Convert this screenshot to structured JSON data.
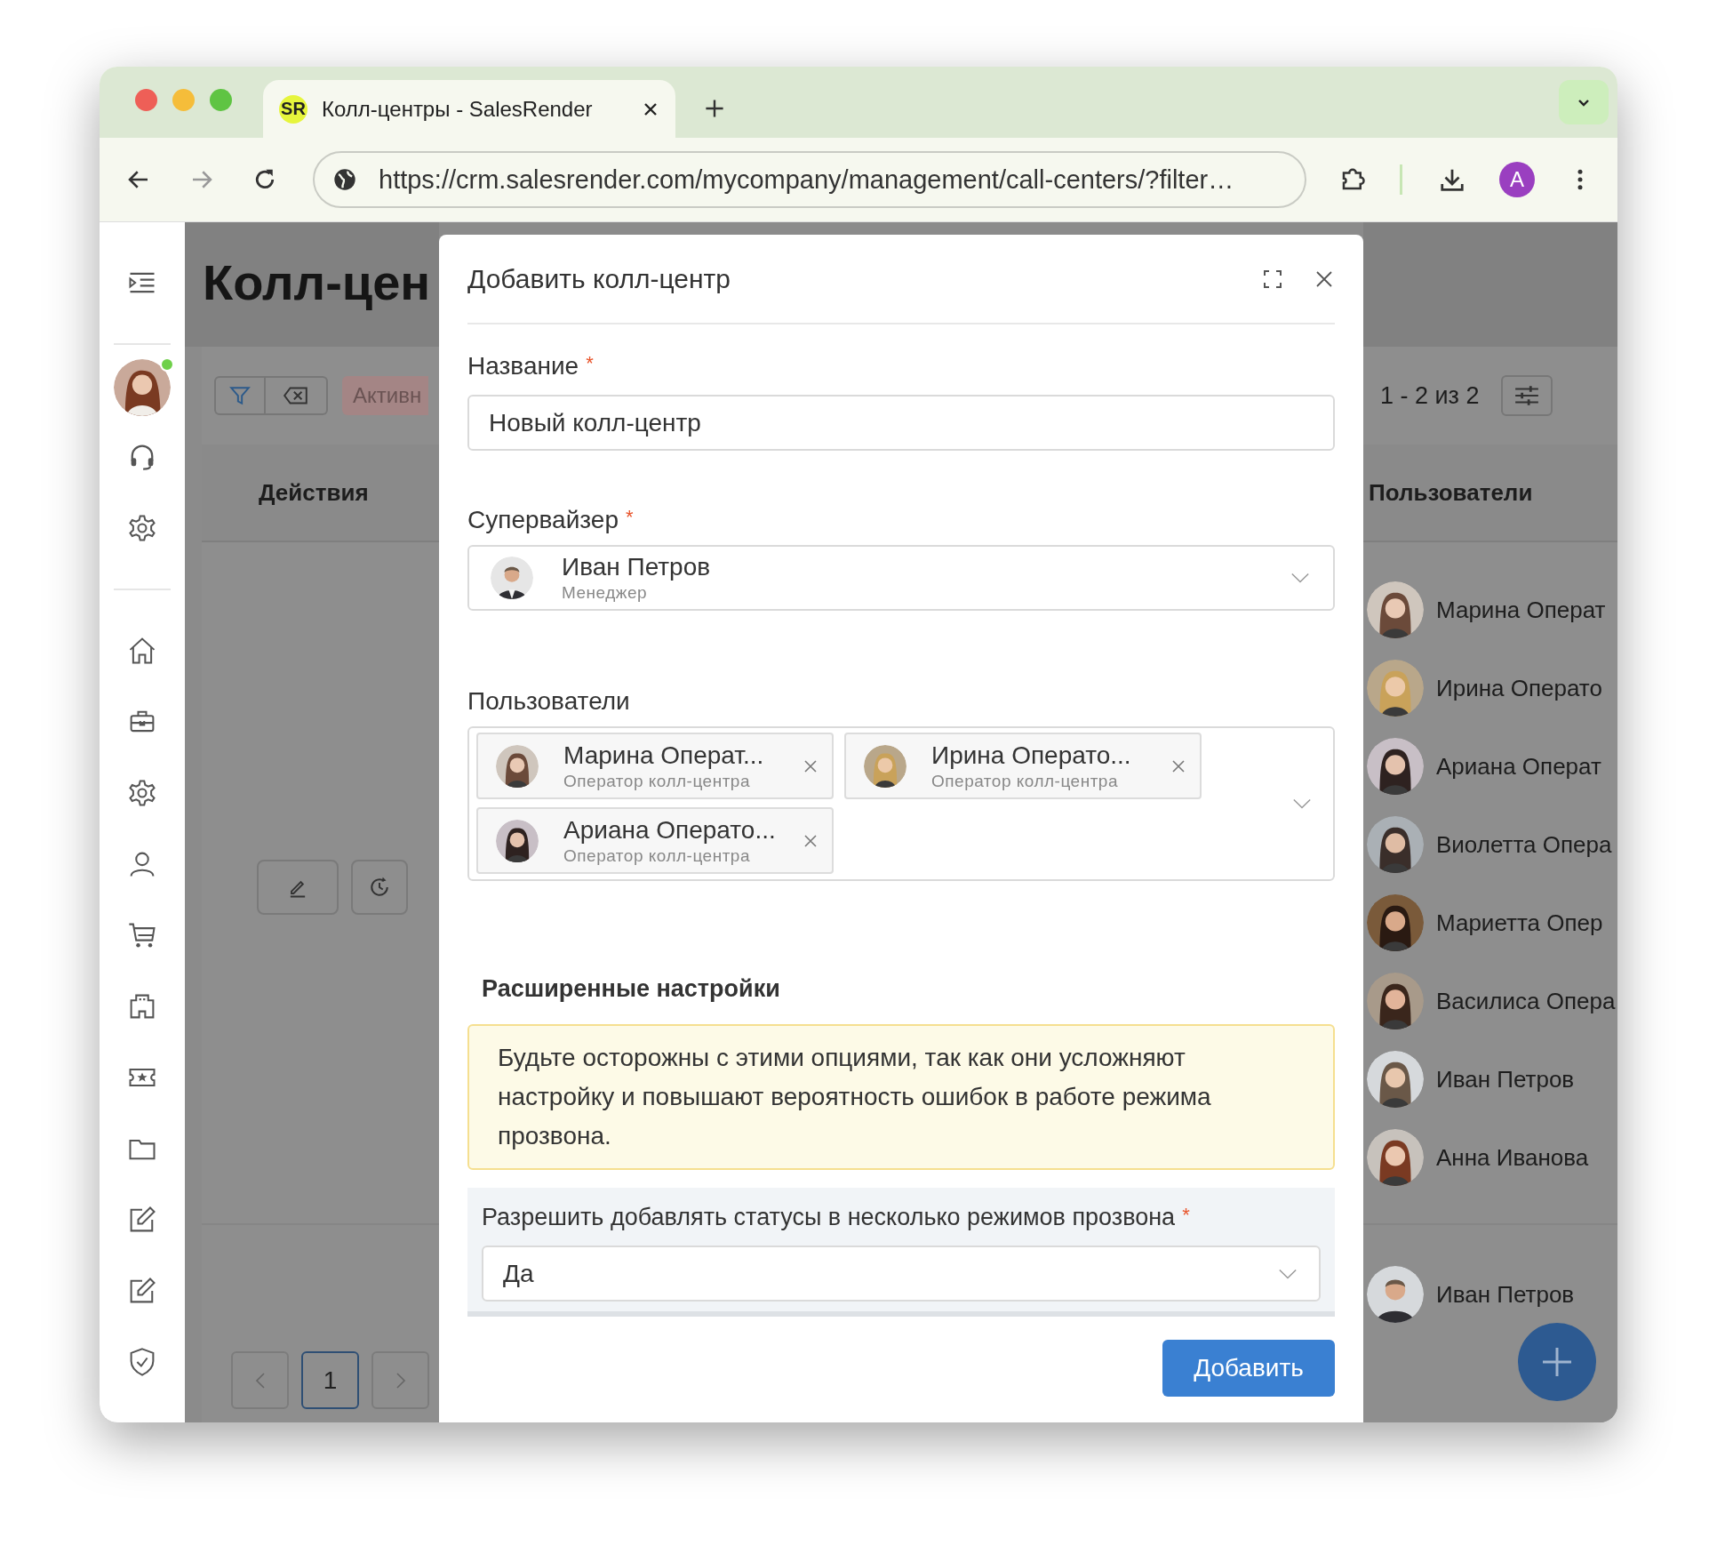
{
  "browser": {
    "tab": {
      "favicon": "SR",
      "title": "Колл-центры - SalesRender"
    },
    "url": "https://crm.salesrender.com/mycompany/management/call-centers/?filter…",
    "profile": "A"
  },
  "sidebar": {
    "user_online": true
  },
  "background": {
    "title": "Колл-цен",
    "filter_chip": "Активн",
    "actions_header": "Действия",
    "range": "1 - 2 из 2",
    "users_header": "Пользователи",
    "users": [
      "Марина Операт",
      "Ирина Операто",
      "Ариана Операт",
      "Виолетта Опера",
      "Мариетта Опер",
      "Василиса Опера",
      "Иван Петров",
      "Анна Иванова"
    ],
    "footer_user": "Иван Петров",
    "pages": [
      {
        "label": "1",
        "selected": true
      }
    ]
  },
  "modal": {
    "title": "Добавить колл-центр",
    "name_field": {
      "label": "Название",
      "required_mark": "*",
      "value": "Новый колл-центр"
    },
    "supervisor_field": {
      "label": "Супервайзер",
      "required_mark": "*",
      "name": "Иван Петров",
      "role": "Менеджер"
    },
    "users_field": {
      "label": "Пользователи",
      "chips": [
        {
          "name": "Марина Операт...",
          "role": "Оператор колл-центра"
        },
        {
          "name": "Ирина Операто...",
          "role": "Оператор колл-центра"
        },
        {
          "name": "Ариана Операто...",
          "role": "Оператор колл-центра"
        }
      ]
    },
    "advanced": {
      "title": "Расширенные настройки",
      "warning": "Будьте осторожны с этими опциями, так как они усложняют настройку и повышают вероятность ошибок в работе режима прозвона.",
      "setting": {
        "label": "Разрешить добавлять статусы в несколько режимов прозвона",
        "required_mark": "*",
        "value": "Да"
      }
    },
    "submit": "Добавить"
  }
}
